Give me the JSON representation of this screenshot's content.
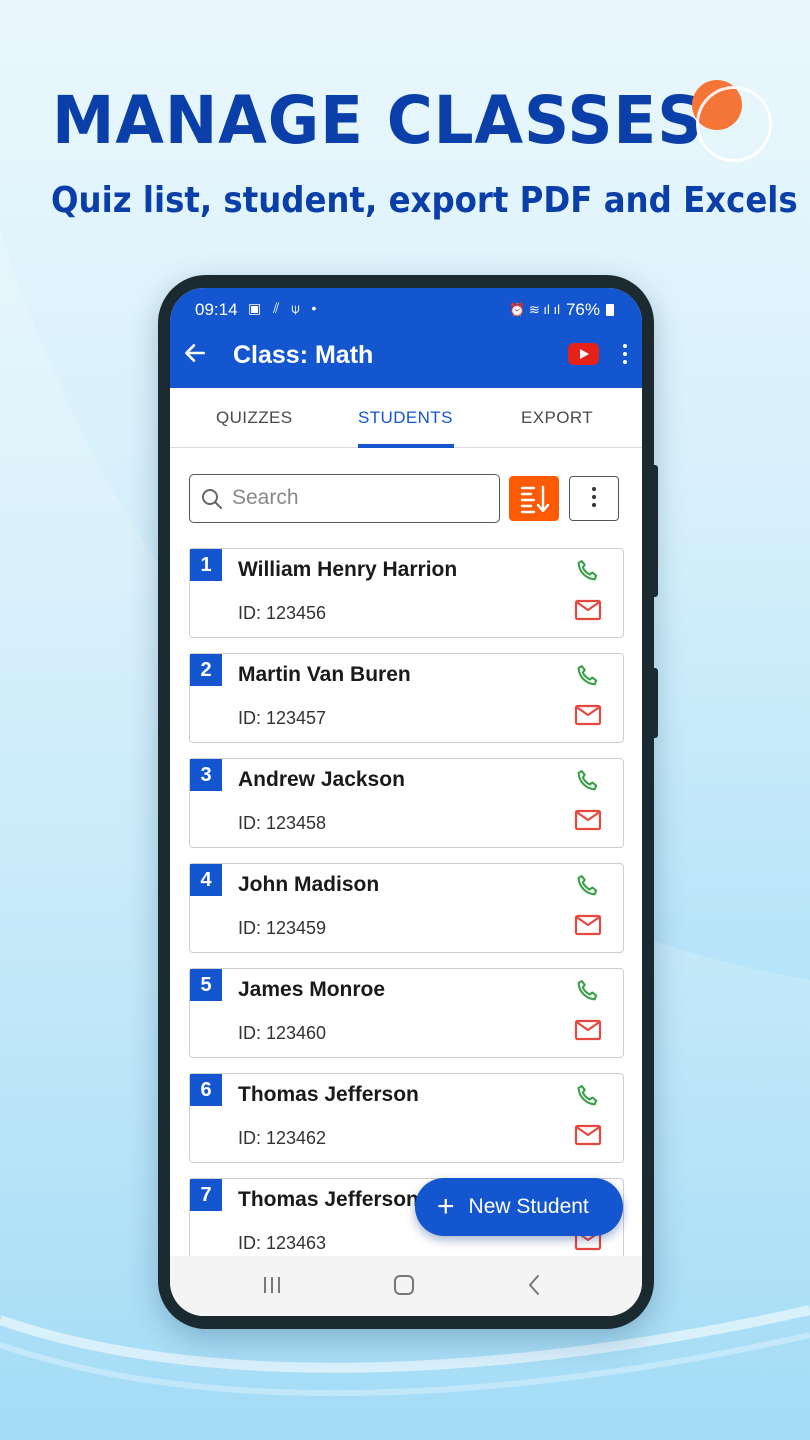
{
  "promo": {
    "title": "MANAGE CLASSES",
    "subtitle": "Quiz list, student, export PDF and Excels"
  },
  "status_bar": {
    "time": "09:14",
    "icons_left": "▣ ⫽ ⍦ •",
    "icons_right": "⏰ ≋ ıl ıl",
    "battery": "76%"
  },
  "app_bar": {
    "title": "Class: Math",
    "back_icon": "arrow-left-icon",
    "youtube_icon": "youtube-icon",
    "menu_icon": "kebab-menu-icon"
  },
  "tabs": [
    {
      "label": "QUIZZES",
      "active": false
    },
    {
      "label": "STUDENTS",
      "active": true
    },
    {
      "label": "EXPORT",
      "active": false
    }
  ],
  "search": {
    "placeholder": "Search",
    "value": ""
  },
  "students": [
    {
      "index": "1",
      "name": "William Henry Harrion",
      "id": "ID: 123456"
    },
    {
      "index": "2",
      "name": "Martin Van Buren",
      "id": "ID: 123457"
    },
    {
      "index": "3",
      "name": "Andrew Jackson",
      "id": "ID: 123458"
    },
    {
      "index": "4",
      "name": "John Madison",
      "id": "ID: 123459"
    },
    {
      "index": "5",
      "name": "James Monroe",
      "id": "ID: 123460"
    },
    {
      "index": "6",
      "name": "Thomas Jefferson",
      "id": "ID: 123462"
    },
    {
      "index": "7",
      "name": "Thomas Jefferson",
      "id": "ID: 123463"
    }
  ],
  "fab": {
    "plus": "+",
    "label": "New Student"
  },
  "colors": {
    "primary": "#1456d0",
    "accent_orange": "#fc5a03",
    "phone_green": "#3aa14a",
    "mail_red": "#e5483f",
    "promo_blue": "#0a3ea9"
  }
}
